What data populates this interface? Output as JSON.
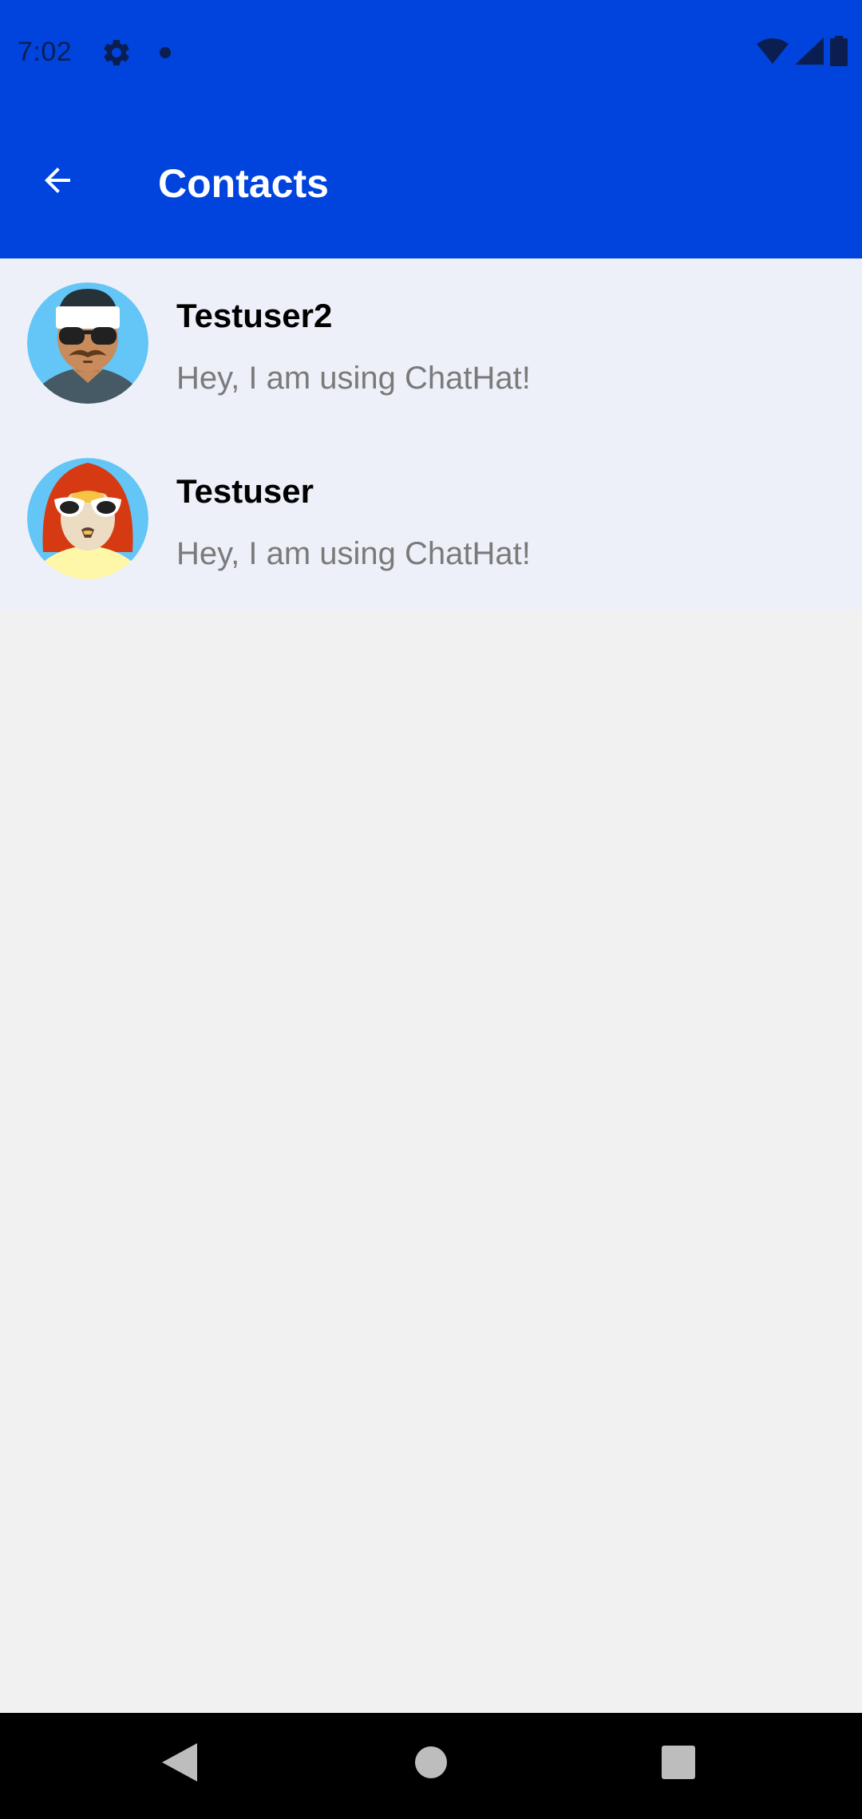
{
  "status_bar": {
    "time": "7:02",
    "icons": [
      "gear-icon",
      "notification-dot-icon",
      "wifi-icon",
      "signal-icon",
      "battery-icon"
    ],
    "background_color": "#0044DD"
  },
  "toolbar": {
    "back_icon": "arrow-left-icon",
    "title": "Contacts",
    "background_color": "#0044DD"
  },
  "contacts": [
    {
      "name": "Testuser2",
      "status": "Hey, I am using ChatHat!",
      "avatar_icon": "man-sunglasses-headband-avatar"
    },
    {
      "name": "Testuser",
      "status": "Hey, I am using ChatHat!",
      "avatar_icon": "redhair-sunglasses-avatar"
    }
  ],
  "nav_bar": {
    "icons": [
      "back-triangle-icon",
      "home-circle-icon",
      "recents-square-icon"
    ]
  }
}
